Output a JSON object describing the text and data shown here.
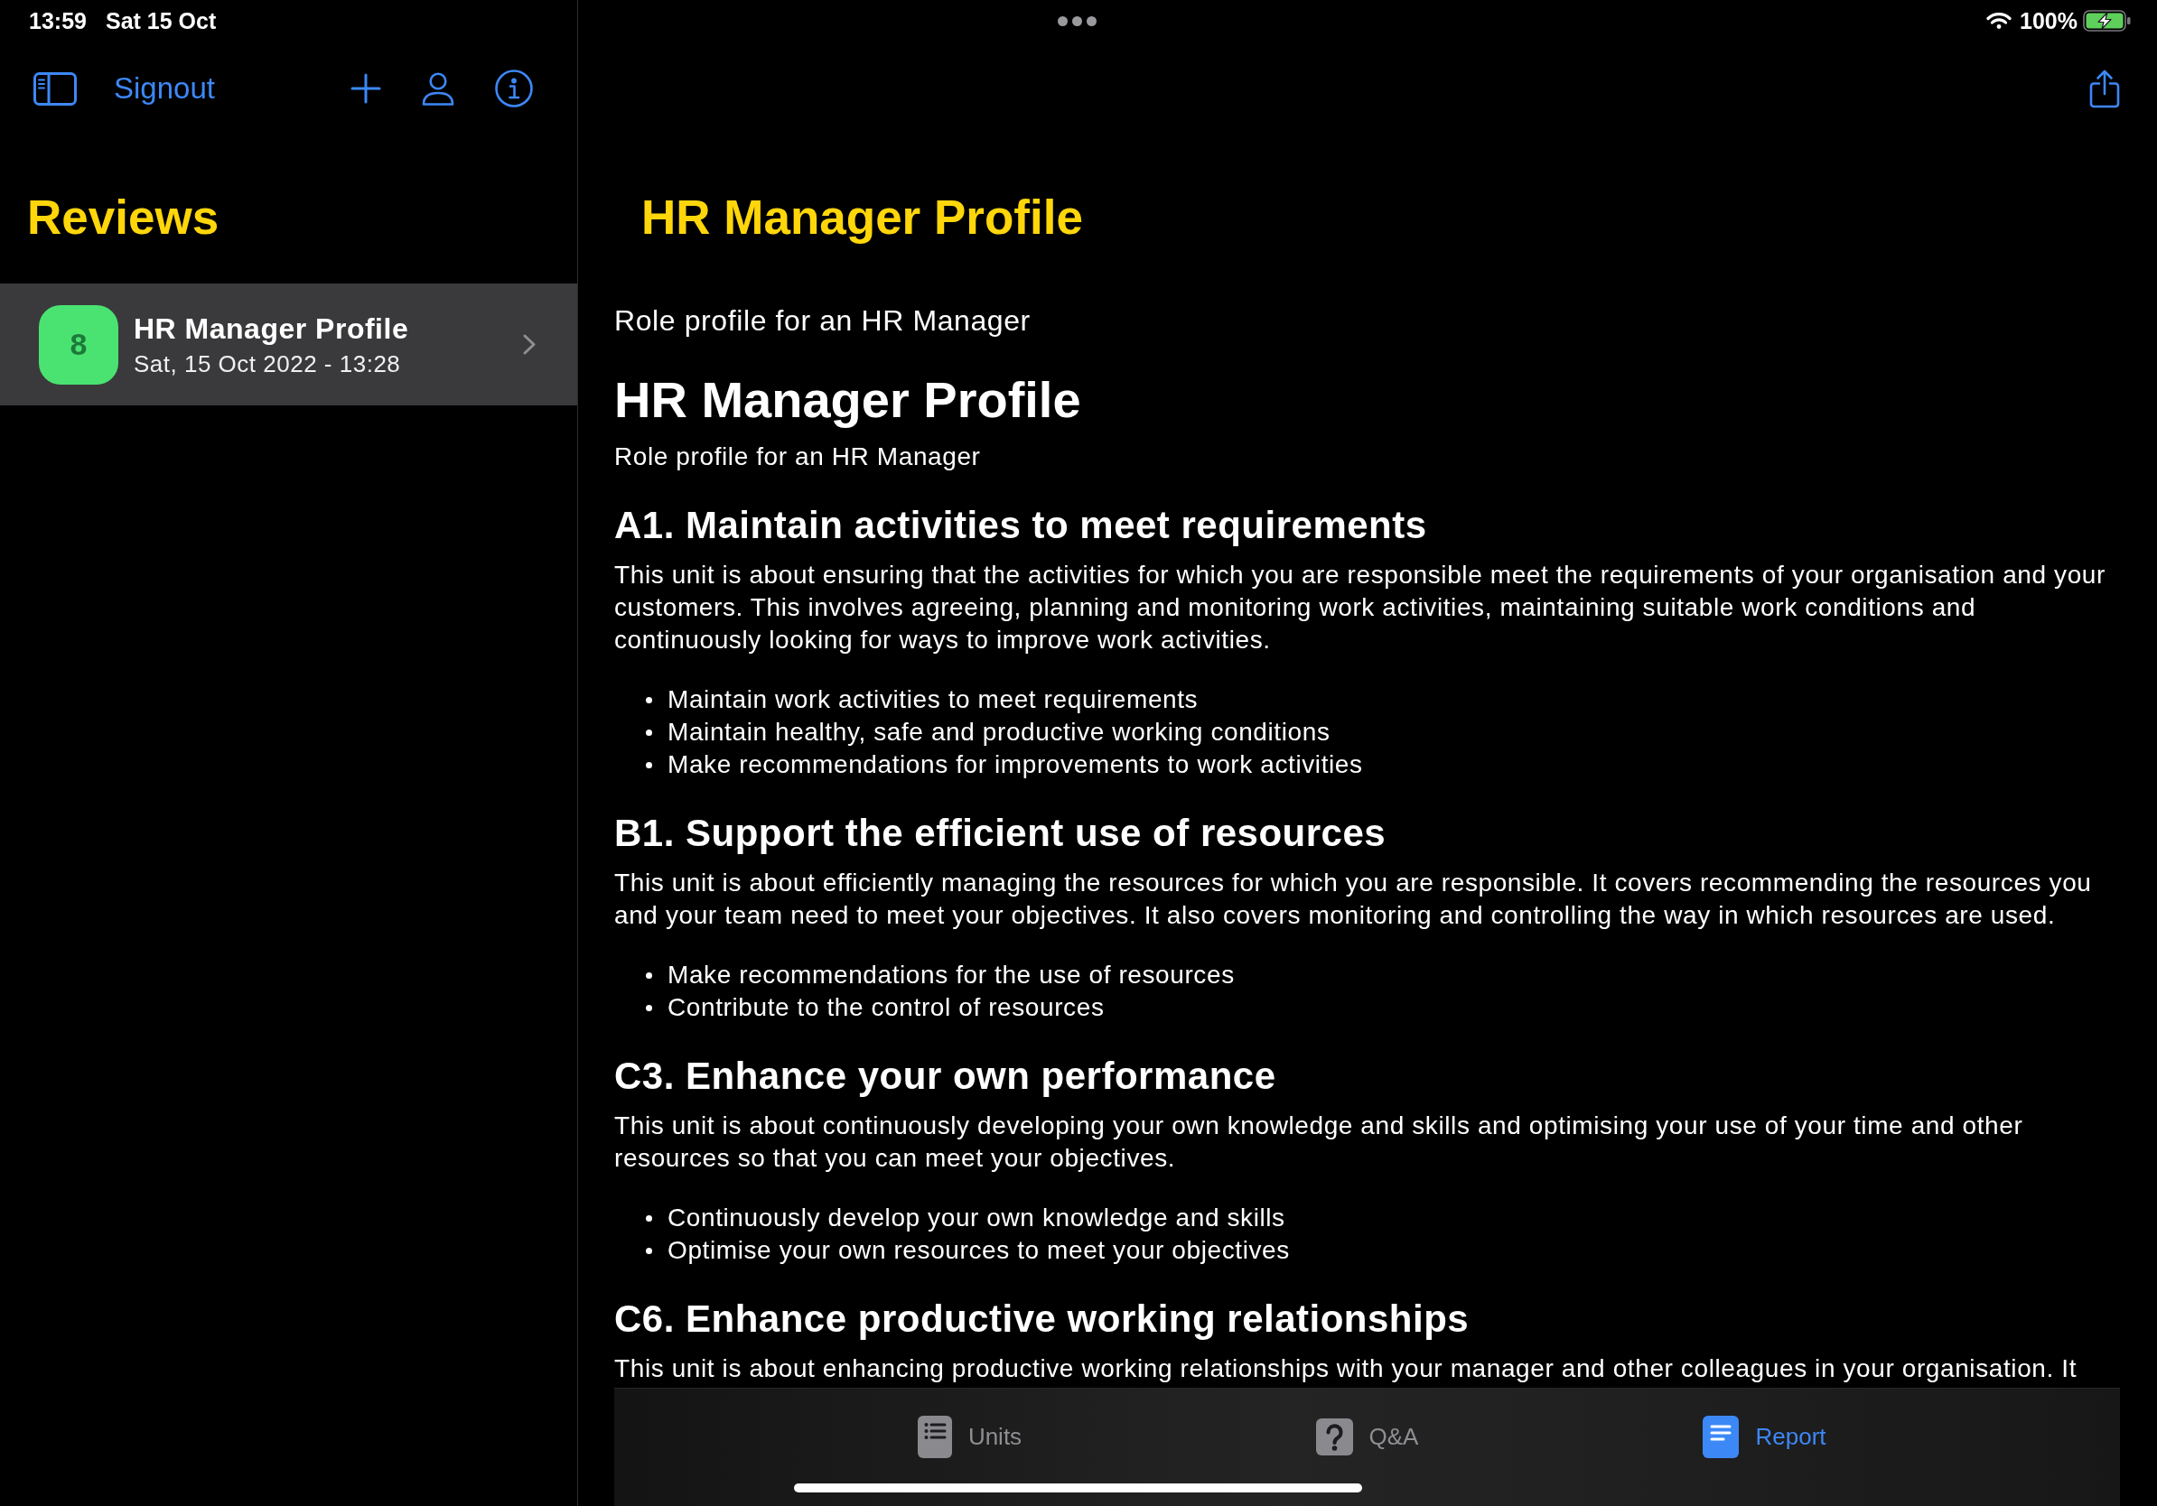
{
  "status_bar": {
    "time": "13:59",
    "date": "Sat 15 Oct",
    "battery": "100%"
  },
  "sidebar": {
    "toolbar": {
      "signout": "Signout"
    },
    "title": "Reviews",
    "items": [
      {
        "badge": "8",
        "color": "#4ae371",
        "title": "HR Manager Profile",
        "subtitle": "Sat, 15 Oct 2022 - 13:28",
        "selected": true
      }
    ]
  },
  "detail": {
    "title": "HR Manager Profile",
    "description": "Role profile for an HR Manager",
    "report": {
      "heading": "HR Manager Profile",
      "subheading": "Role profile for an HR Manager",
      "sections": [
        {
          "heading": "A1. Maintain activities to meet requirements",
          "paragraph": "This unit is about ensuring that the activities for which you are responsible meet the requirements of your organisation and your customers. This involves agreeing, planning and monitoring work activities, maintaining suitable work conditions and continuously looking for ways to improve work activities.",
          "bullets": [
            "Maintain work activities to meet requirements",
            "Maintain healthy, safe and productive working conditions",
            "Make recommendations for improvements to work activities"
          ]
        },
        {
          "heading": "B1. Support the efficient use of resources",
          "paragraph": "This unit is about efficiently managing the resources for which you are responsible. It covers recommending the resources you and your team need to meet your objectives. It also covers monitoring and controlling the way in which resources are used.",
          "bullets": [
            "Make recommendations for the use of resources",
            "Contribute to the control of resources"
          ]
        },
        {
          "heading": "C3. Enhance your own performance",
          "paragraph": "This unit is about continuously developing your own knowledge and skills and optimising your use of your time and other resources so that you can meet your objectives.",
          "bullets": [
            "Continuously develop your own knowledge and skills",
            "Optimise your own resources to meet your objectives"
          ]
        },
        {
          "heading": "C6. Enhance productive working relationships",
          "paragraph": "This unit is about enhancing productive working relationships with your manager and other colleagues in your organisation. It"
        }
      ]
    }
  },
  "tab_bar": {
    "tabs": [
      {
        "label": "Units",
        "kind": "units",
        "selected": false
      },
      {
        "label": "Q&A",
        "kind": "questions",
        "selected": false
      },
      {
        "label": "Report",
        "kind": "report",
        "selected": true
      }
    ]
  }
}
